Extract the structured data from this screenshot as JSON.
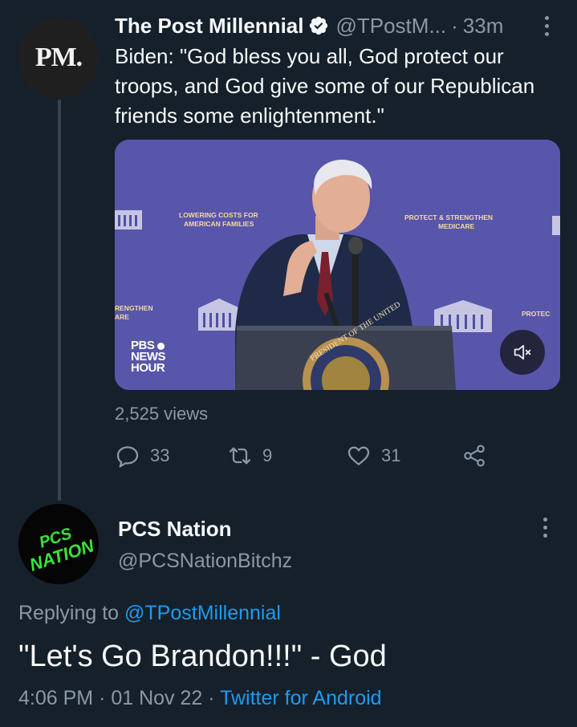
{
  "original_tweet": {
    "avatar_text": "PM.",
    "display_name": "The Post Millennial",
    "handle": "@TPostM...",
    "separator": "·",
    "time_ago": "33m",
    "text": "Biden: \"God bless you all, God protect our troops, and God give some of our Republican friends some enlightenment.\"",
    "media": {
      "banner_left": "LOWERING COSTS FOR AMERICAN FAMILIES",
      "banner_right": "PROTECT & STRENGTHEN MEDICARE",
      "banner_far_left": "RENGTHEN ARE",
      "banner_far_right": "PROTEC",
      "seal_text": "PRESIDENT OF THE UNITED",
      "network_logo": [
        "PBS",
        "NEWS",
        "HOUR"
      ],
      "mute_icon": "volume-muted-icon"
    },
    "views": "2,525 views",
    "actions": {
      "reply_count": "33",
      "retweet_count": "9",
      "like_count": "31"
    }
  },
  "reply_tweet": {
    "avatar_text": "PCS NATION",
    "display_name": "PCS Nation",
    "handle": "@PCSNationBitchz",
    "replying_prefix": "Replying to",
    "replying_to": "@TPostMillennial",
    "text": "\"Let's Go Brandon!!!\" - God",
    "time": "4:06 PM",
    "date": "01 Nov 22",
    "separator": "·",
    "source": "Twitter for Android"
  },
  "colors": {
    "background": "#15202b",
    "primary_text": "#f7f9f9",
    "secondary_text": "#8b98a5",
    "link": "#1d9bf0",
    "pcs_green": "#39e33a"
  }
}
